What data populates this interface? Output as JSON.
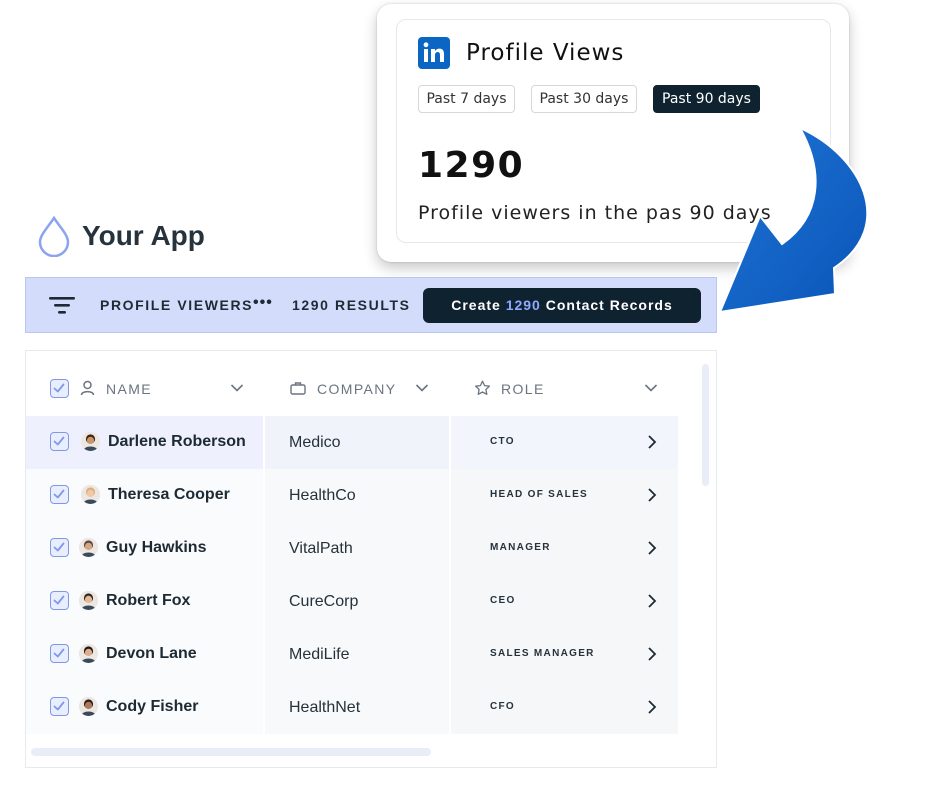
{
  "profile_views": {
    "title": "Profile Views",
    "logo_text": "in",
    "ranges": [
      "Past 7 days",
      "Past 30 days",
      "Past 90 days"
    ],
    "active_range": "Past 90 days",
    "count": "1290",
    "subtitle": "Profile viewers in the pas 90 days"
  },
  "app": {
    "name": "Your App"
  },
  "toolbar": {
    "filter_label": "PROFILE VIEWERS",
    "more": "•••",
    "results": "1290 RESULTS",
    "create_prefix": "Create ",
    "create_count": "1290",
    "create_suffix": " Contact Records"
  },
  "table": {
    "columns": [
      "NAME",
      "COMPANY",
      "ROLE"
    ],
    "rows": [
      {
        "name": "Darlene Roberson",
        "company": "Medico",
        "role": "CTO"
      },
      {
        "name": "Theresa Cooper",
        "company": "HealthCo",
        "role": "HEAD OF SALES"
      },
      {
        "name": "Guy Hawkins",
        "company": "VitalPath",
        "role": "MANAGER"
      },
      {
        "name": "Robert Fox",
        "company": "CureCorp",
        "role": "CEO"
      },
      {
        "name": "Devon Lane",
        "company": "MediLife",
        "role": "SALES MANAGER"
      },
      {
        "name": "Cody Fisher",
        "company": "HealthNet",
        "role": "CFO"
      }
    ]
  },
  "colors": {
    "accent": "#0a66c2",
    "dark": "#0f2230",
    "toolbar_bg": "#d4dcfb",
    "checkbox": "#7f99e8",
    "highlight_num": "#8fa9ff"
  },
  "icons": [
    "linkedin-icon",
    "curved-arrow-icon",
    "drop-icon",
    "filter-icon",
    "user-icon",
    "briefcase-icon",
    "star-icon",
    "chevron-down-icon",
    "chevron-right-icon",
    "check-icon"
  ]
}
